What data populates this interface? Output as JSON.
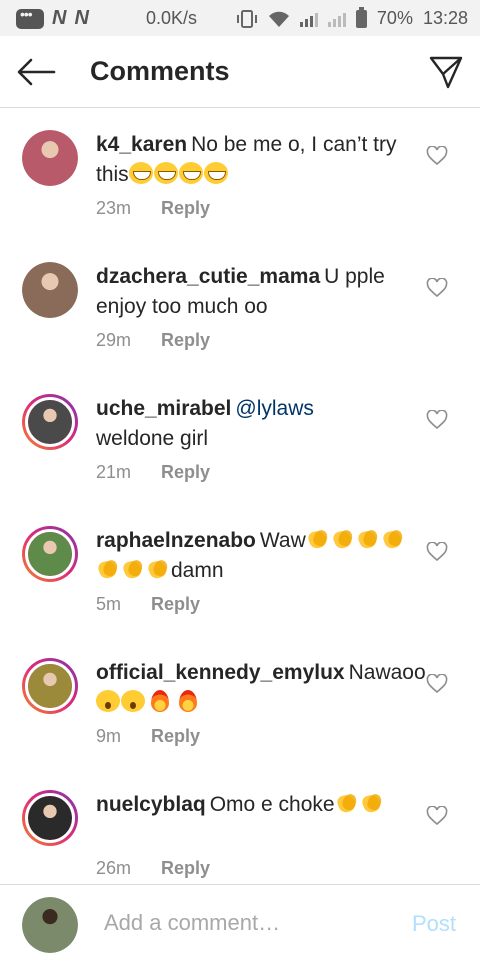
{
  "status_bar": {
    "network_letters": [
      "N",
      "N"
    ],
    "speed": "0.0K/s",
    "battery": "70%",
    "time": "13:28"
  },
  "header": {
    "title": "Comments"
  },
  "comments": [
    {
      "username": "k4_karen",
      "text": "No be me o, I can’t try this",
      "mention": "",
      "emojis": [
        "laugh",
        "laugh",
        "laugh",
        "laugh"
      ],
      "emoji_suffix": "",
      "time": "23m",
      "reply_label": "Reply",
      "avatar_color": "#b85a6a",
      "story_ring": false
    },
    {
      "username": "dzachera_cutie_mama",
      "text": "U pple enjoy too much oo",
      "mention": "",
      "emojis": [],
      "emoji_suffix": "",
      "time": "29m",
      "reply_label": "Reply",
      "avatar_color": "#8a6a58",
      "story_ring": false
    },
    {
      "username": "uche_mirabel",
      "text": "weldone girl",
      "mention": "@lylaws",
      "emojis": [],
      "emoji_suffix": "",
      "time": "21m",
      "reply_label": "Reply",
      "avatar_color": "#4a4a4a",
      "story_ring": true
    },
    {
      "username": "raphaelnzenabo",
      "text": "Waw",
      "mention": "",
      "emojis": [
        "clap",
        "clap",
        "clap",
        "clap",
        "clap",
        "clap",
        "clap"
      ],
      "emoji_suffix": "damn",
      "time": "5m",
      "reply_label": "Reply",
      "avatar_color": "#5e8a4a",
      "story_ring": true
    },
    {
      "username": "official_kennedy_emylux",
      "text": "Nawaoo",
      "mention": "",
      "emojis": [
        "shock",
        "shock",
        "fire",
        "fire"
      ],
      "emoji_suffix": "",
      "time": "9m",
      "reply_label": "Reply",
      "avatar_color": "#9a8a3a",
      "story_ring": true
    },
    {
      "username": "nuelcyblaq",
      "text": "Omo e choke",
      "mention": "",
      "emojis": [
        "clap",
        "clap"
      ],
      "emoji_suffix": "",
      "time": "26m",
      "reply_label": "Reply",
      "avatar_color": "#2a2a2a",
      "story_ring": true
    }
  ],
  "composer": {
    "placeholder": "Add a comment…",
    "post_label": "Post",
    "avatar_color": "#7a8a6a"
  },
  "colors": {
    "link": "#003569",
    "post_disabled": "#b2dffc",
    "meta": "#8e8e8e"
  }
}
